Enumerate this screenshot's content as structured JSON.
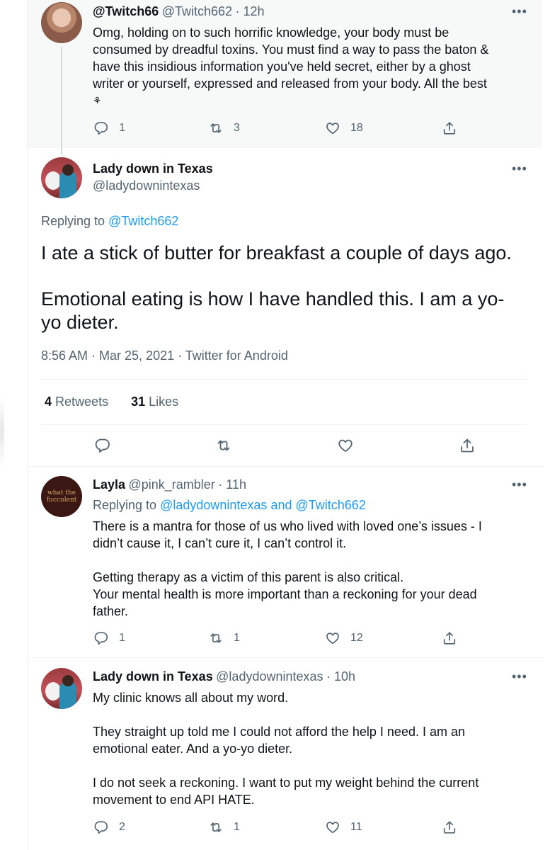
{
  "tweet1": {
    "name": "@Twitch66",
    "handle": "@Twitch662",
    "time": "· 12h",
    "lines": [
      "Omg, holding on to such horrific knowledge, your body must be",
      "consumed by dreadful toxins. You must find a way to pass the baton &",
      "have this insidious information you've held secret, either by a ghost",
      "writer or yourself,  expressed and released from your body. All the best",
      "⚘"
    ],
    "replies": "1",
    "retweets": "3",
    "likes": "18"
  },
  "main": {
    "name": "Lady down in Texas",
    "handle": "@ladydownintexas",
    "replying_prefix": "Replying to",
    "replying_to": "@Twitch662",
    "text_line1": "I ate a stick of butter for breakfast a couple of days ago.",
    "text_line2": "Emotional eating is how I have handled this. I am a yo-",
    "text_line3": "yo dieter.",
    "meta": "8:56 AM · Mar 25, 2021 · Twitter for Android",
    "retweet_count": "4",
    "retweet_label": "Retweets",
    "like_count": "31",
    "like_label": "Likes"
  },
  "tweet3": {
    "name": "Layla",
    "handle": "@pink_rambler",
    "time": "· 11h",
    "avatar_text": "what the fucculent",
    "replying_prefix": "Replying to",
    "replying_to1": "@ladydownintexas",
    "replying_and": "and",
    "replying_to2": "@Twitch662",
    "lines": [
      "There is a mantra for those of us who lived with loved one’s issues - I",
      "didn’t cause it, I can’t cure it, I can’t control it.",
      "",
      "Getting therapy as a victim of this parent is also critical.",
      "Your mental health is more important than a reckoning for your dead",
      "father."
    ],
    "replies": "1",
    "retweets": "1",
    "likes": "12"
  },
  "tweet4": {
    "name": "Lady down in Texas",
    "handle": "@ladydownintexas",
    "time": "· 10h",
    "lines": [
      "My clinic knows all about my word.",
      "",
      "They straight up told me I could not afford the help I need. I am an",
      "emotional eater. And a yo-yo dieter.",
      "",
      "I do not seek a reckoning. I want to put my weight behind the current",
      "movement to end API HATE."
    ],
    "replies": "2",
    "retweets": "1",
    "likes": "11"
  },
  "more_label": "•••",
  "icons": [
    "reply-icon",
    "retweet-icon",
    "like-icon",
    "share-icon",
    "more-icon"
  ],
  "colors": {
    "link": "#1d9bf0",
    "muted": "#536471",
    "text": "#0f1419",
    "highlight_bg": "#f7f9f9"
  }
}
